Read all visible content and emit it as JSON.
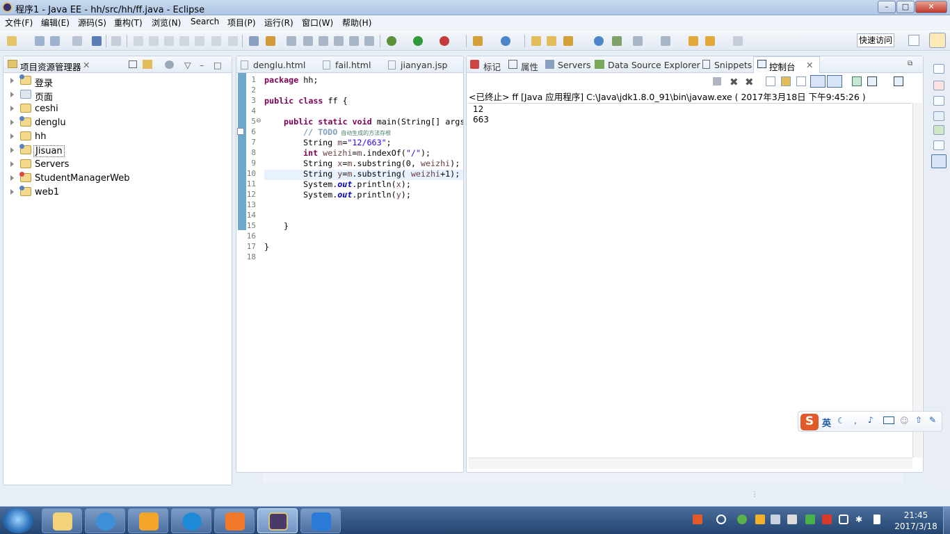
{
  "window": {
    "title": "程序1 - Java EE - hh/src/hh/ff.java - Eclipse",
    "min": "–",
    "max": "□",
    "close": "✕"
  },
  "menu": [
    "文件(F)",
    "编辑(E)",
    "源码(S)",
    "重构(T)",
    "浏览(N)",
    "Search",
    "项目(P)",
    "运行(R)",
    "窗口(W)",
    "帮助(H)"
  ],
  "quick_access": "快速访问",
  "left_panel": {
    "title": "项目资源管理器",
    "items": [
      "登录",
      "页面",
      "ceshi",
      "denglu",
      "hh",
      "Jisuan",
      "Servers",
      "StudentManagerWeb",
      "web1"
    ]
  },
  "editor": {
    "tabs": [
      "denglu.html",
      "fail.html",
      "jianyan.jsp"
    ],
    "line_numbers": [
      "1",
      "2",
      "3",
      "4",
      "5",
      "6",
      "7",
      "8",
      "9",
      "10",
      "11",
      "12",
      "13",
      "14",
      "15",
      "16",
      "17",
      "18"
    ],
    "code": {
      "l1_kw": "package",
      "l1_rest": " hh;",
      "l3_kw": "public class",
      "l3_rest": " ff {",
      "l5_kw": "public static void",
      "l5_rest": " main(String[] args",
      "l6_todo": "// TODO",
      "l6_note": " 自动生成的方法存根",
      "l7_a": "String ",
      "l7_b": "m",
      "l7_c": "=",
      "l7_str": "\"12/663\"",
      "l7_d": ";",
      "l8_kw": "int",
      "l8_a": " ",
      "l8_b": "weizhi",
      "l8_c": "=",
      "l8_d": "m",
      "l8_e": ".indexOf(",
      "l8_str": "\"/\"",
      "l8_f": ");",
      "l9_a": "String ",
      "l9_b": "x",
      "l9_c": "=",
      "l9_d": "m",
      "l9_e": ".substring(0, ",
      "l9_f": "weizhi",
      "l9_g": ");",
      "l10_a": "String ",
      "l10_b": "y",
      "l10_c": "=",
      "l10_d": "m",
      "l10_e": ".substring( ",
      "l10_f": "weizhi",
      "l10_g": "+1);",
      "l11_a": "System.",
      "l11_out": "out",
      "l11_b": ".println(",
      "l11_v": "x",
      "l11_c": ");",
      "l12_a": "System.",
      "l12_out": "out",
      "l12_b": ".println(",
      "l12_v": "y",
      "l12_c": ");",
      "l15": "}",
      "l17": "}"
    }
  },
  "console_panel": {
    "tabs": [
      "标记",
      "属性",
      "Servers",
      "Data Source Explorer",
      "Snippets",
      "控制台"
    ],
    "status": "<已终止> ff [Java 应用程序] C:\\Java\\jdk1.8.0_91\\bin\\javaw.exe ( 2017年3月18日 下午9:45:26 )",
    "output": [
      "12",
      "663"
    ]
  },
  "ime": {
    "mode": "英"
  },
  "taskbar": {
    "time": "21:45",
    "date": "2017/3/18",
    "apps": [
      "explorer",
      "internet-explorer",
      "kingsoft",
      "skype",
      "wps-presentation",
      "eclipse-java-ee",
      "wps-writer"
    ]
  },
  "colors": {
    "keyword": "#7f0055",
    "string": "#2a00ff",
    "comment": "#3f7f5f",
    "field": "#0000c0"
  }
}
